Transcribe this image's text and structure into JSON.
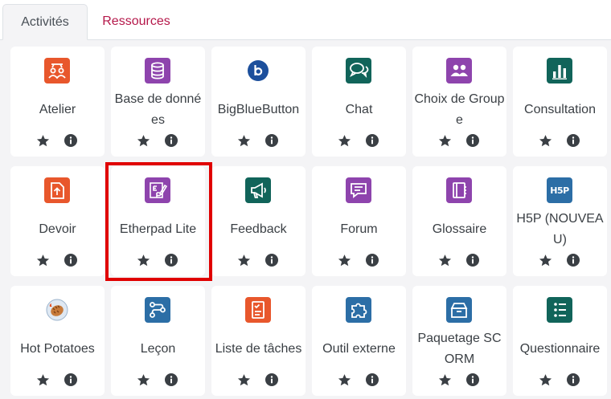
{
  "tabs": [
    {
      "label": "Activités",
      "active": true
    },
    {
      "label": "Ressources",
      "active": false
    }
  ],
  "colors": {
    "orange": "#e8572c",
    "purple": "#8e44ad",
    "teal": "#11645a",
    "blue": "#2c6ea6",
    "bbb": "#1c4f9c",
    "link": "#b5184a",
    "highlight": "#e00000"
  },
  "activities": [
    {
      "name": "Atelier",
      "icon": "workshop-icon",
      "color": "#e8572c"
    },
    {
      "name": "Base de données",
      "icon": "database-icon",
      "color": "#8e44ad"
    },
    {
      "name": "BigBlueButton",
      "icon": "bigbluebutton-icon",
      "color": "#1c4f9c"
    },
    {
      "name": "Chat",
      "icon": "chat-icon",
      "color": "#11645a"
    },
    {
      "name": "Choix de Groupe",
      "icon": "group-choice-icon",
      "color": "#8e44ad"
    },
    {
      "name": "Consultation",
      "icon": "poll-chart-icon",
      "color": "#11645a"
    },
    {
      "name": "Devoir",
      "icon": "assignment-upload-icon",
      "color": "#e8572c"
    },
    {
      "name": "Etherpad Lite",
      "icon": "etherpad-icon",
      "color": "#8e44ad",
      "highlighted": true
    },
    {
      "name": "Feedback",
      "icon": "megaphone-icon",
      "color": "#11645a"
    },
    {
      "name": "Forum",
      "icon": "forum-icon",
      "color": "#8e44ad"
    },
    {
      "name": "Glossaire",
      "icon": "glossary-book-icon",
      "color": "#8e44ad"
    },
    {
      "name": "H5P (NOUVEAU)",
      "icon": "h5p-icon",
      "color": "#2c6ea6",
      "icon_text": "H5P"
    },
    {
      "name": "Hot Potatoes",
      "icon": "hot-potatoes-icon",
      "color": "#c0392b"
    },
    {
      "name": "Leçon",
      "icon": "lesson-path-icon",
      "color": "#2c6ea6"
    },
    {
      "name": "Liste de tâches",
      "icon": "checklist-icon",
      "color": "#e8572c"
    },
    {
      "name": "Outil externe",
      "icon": "puzzle-icon",
      "color": "#2c6ea6"
    },
    {
      "name": "Paquetage SCORM",
      "icon": "scorm-package-icon",
      "color": "#2c6ea6"
    },
    {
      "name": "Questionnaire",
      "icon": "questionnaire-icon",
      "color": "#11645a"
    }
  ]
}
